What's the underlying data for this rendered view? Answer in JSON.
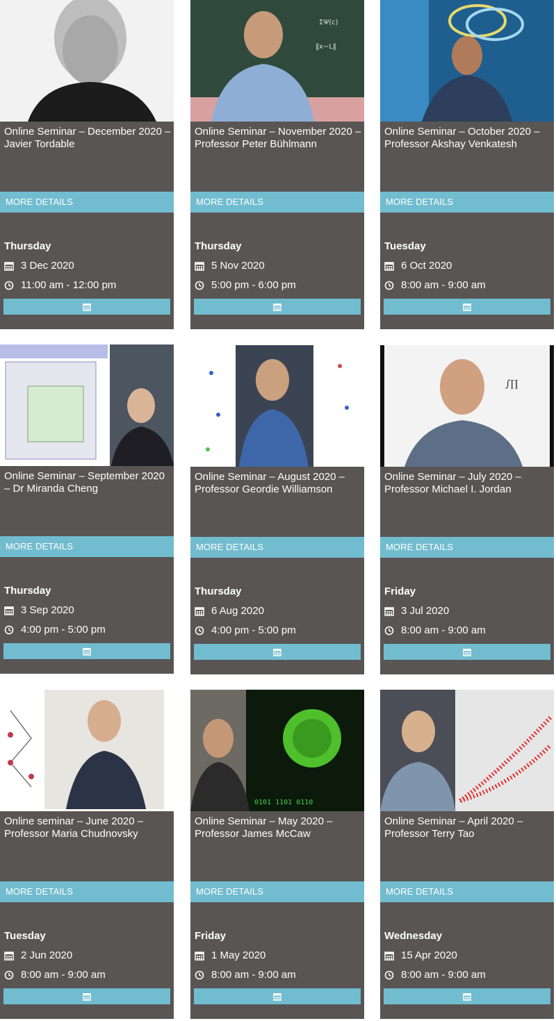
{
  "more_label": "MORE DETAILS",
  "colors": {
    "card_bg": "#595554",
    "accent": "#72bccf",
    "text": "#ffffff"
  },
  "events": [
    {
      "title": "Online Seminar – December 2020 – Javier Tordable",
      "day": "Thursday",
      "date": "3 Dec 2020",
      "time": "11:00 am - 12:00 pm",
      "photo": "portrait-javier-tordable"
    },
    {
      "title": "Online Seminar – November 2020 – Professor Peter Bühlmann",
      "day": "Thursday",
      "date": "5 Nov 2020",
      "time": "5:00 pm - 6:00 pm",
      "photo": "portrait-peter-buhlmann"
    },
    {
      "title": "Online Seminar – October 2020 – Professor Akshay Venkatesh",
      "day": "Tuesday",
      "date": "6 Oct 2020",
      "time": "8:00 am - 9:00 am",
      "photo": "portrait-akshay-venkatesh"
    },
    {
      "title": "Online Seminar – September 2020 – Dr Miranda Cheng",
      "day": "Thursday",
      "date": "3 Sep 2020",
      "time": "4:00 pm - 5:00 pm",
      "photo": "portrait-miranda-cheng"
    },
    {
      "title": "Online Seminar – August 2020 – Professor Geordie Williamson",
      "day": "Thursday",
      "date": "6 Aug 2020",
      "time": "4:00 pm - 5:00 pm",
      "photo": "portrait-geordie-williamson"
    },
    {
      "title": "Online Seminar – July 2020 – Professor Michael I. Jordan",
      "day": "Friday",
      "date": "3 Jul 2020",
      "time": "8:00 am - 9:00 am",
      "photo": "portrait-michael-jordan"
    },
    {
      "title": "Online seminar – June 2020 – Professor Maria Chudnovsky",
      "day": "Tuesday",
      "date": "2 Jun 2020",
      "time": "8:00 am - 9:00 am",
      "photo": "portrait-maria-chudnovsky"
    },
    {
      "title": "Online Seminar – May 2020 – Professor James McCaw",
      "day": "Friday",
      "date": "1 May 2020",
      "time": "8:00 am - 9:00 am",
      "photo": "portrait-james-mccaw"
    },
    {
      "title": "Online Seminar – April 2020 – Professor Terry Tao",
      "day": "Wednesday",
      "date": "15 Apr 2020",
      "time": "8:00 am - 9:00 am",
      "photo": "portrait-terry-tao"
    }
  ]
}
